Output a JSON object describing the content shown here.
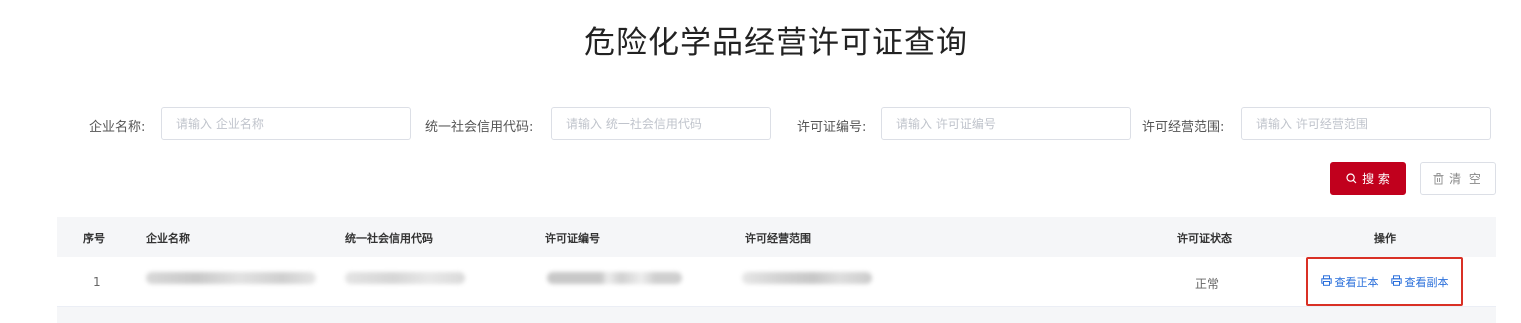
{
  "page": {
    "title": "危险化学品经营许可证查询"
  },
  "filters": {
    "company": {
      "label": "企业名称:",
      "placeholder": "请输入 企业名称",
      "value": ""
    },
    "credit_code": {
      "label": "统一社会信用代码:",
      "placeholder": "请输入 统一社会信用代码",
      "value": ""
    },
    "license_no": {
      "label": "许可证编号:",
      "placeholder": "请输入 许可证编号",
      "value": ""
    },
    "scope": {
      "label": "许可经营范围:",
      "placeholder": "请输入 许可经营范围",
      "value": ""
    }
  },
  "buttons": {
    "search": "搜 索",
    "clear": "清 空"
  },
  "table": {
    "headers": {
      "index": "序号",
      "company": "企业名称",
      "credit_code": "统一社会信用代码",
      "license_no": "许可证编号",
      "scope": "许可经营范围",
      "status": "许可证状态",
      "actions": "操作"
    },
    "rows": [
      {
        "index": "1",
        "status": "正常",
        "view_original": "查看正本",
        "view_copy": "查看副本"
      }
    ]
  },
  "colors": {
    "accent": "#c1001d",
    "link": "#2a6fdb",
    "highlight_border": "#d93025"
  }
}
